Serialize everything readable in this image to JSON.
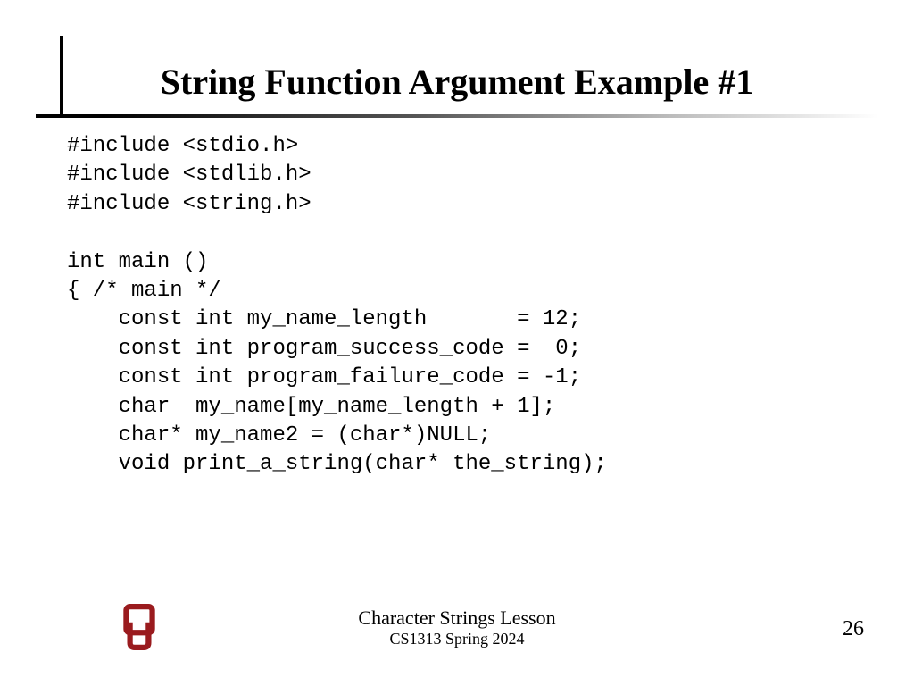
{
  "title": "String Function Argument Example #1",
  "code": "#include <stdio.h>\n#include <stdlib.h>\n#include <string.h>\n\nint main ()\n{ /* main */\n    const int my_name_length       = 12;\n    const int program_success_code =  0;\n    const int program_failure_code = -1;\n    char  my_name[my_name_length + 1];\n    char* my_name2 = (char*)NULL;\n    void print_a_string(char* the_string);",
  "footer": {
    "lesson": "Character Strings Lesson",
    "course": "CS1313 Spring 2024"
  },
  "page_number": "26",
  "logo": {
    "name": "university-of-oklahoma-logo",
    "color": "#9a1b1e"
  }
}
